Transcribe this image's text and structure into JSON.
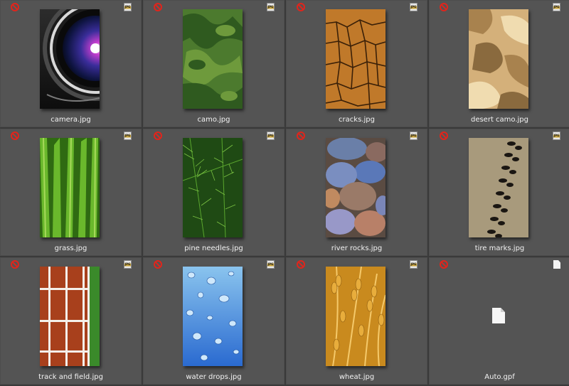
{
  "files": [
    {
      "name": "camera.jpg",
      "type": "jpg",
      "thumb": "camera"
    },
    {
      "name": "camo.jpg",
      "type": "jpg",
      "thumb": "camo"
    },
    {
      "name": "cracks.jpg",
      "type": "jpg",
      "thumb": "cracks"
    },
    {
      "name": "desert camo.jpg",
      "type": "jpg",
      "thumb": "desert-camo"
    },
    {
      "name": "grass.jpg",
      "type": "jpg",
      "thumb": "grass"
    },
    {
      "name": "pine needles.jpg",
      "type": "jpg",
      "thumb": "pine-needles"
    },
    {
      "name": "river rocks.jpg",
      "type": "jpg",
      "thumb": "river-rocks"
    },
    {
      "name": "tire marks.jpg",
      "type": "jpg",
      "thumb": "tire-marks"
    },
    {
      "name": "track and field.jpg",
      "type": "jpg",
      "thumb": "track-and-field"
    },
    {
      "name": "water drops.jpg",
      "type": "jpg",
      "thumb": "water-drops"
    },
    {
      "name": "wheat.jpg",
      "type": "jpg",
      "thumb": "wheat"
    },
    {
      "name": "Auto.gpf",
      "type": "gpf",
      "thumb": "document"
    }
  ],
  "icons": {
    "status": "no-entry-icon",
    "jpg": "jpg-file-icon",
    "gpf": "document-icon"
  },
  "colors": {
    "background": "#3a3a3a",
    "cell": "#545454",
    "status_red": "#e0251c",
    "caption": "#f2f2f2"
  }
}
